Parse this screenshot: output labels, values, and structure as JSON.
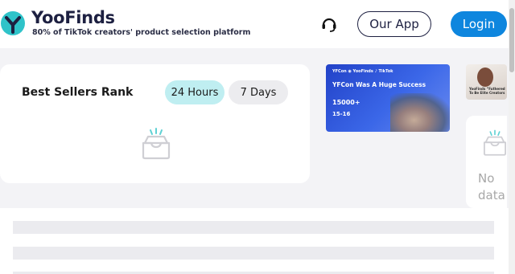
{
  "header": {
    "brand_name": "YooFinds",
    "tagline": "80% of TikTok creators' product selection platform",
    "app_button": "Our App",
    "login_button": "Login",
    "support_icon": "headset-icon"
  },
  "rank": {
    "title": "Best Sellers Rank",
    "tabs": [
      {
        "label": "24 Hours",
        "active": true
      },
      {
        "label": "7 Days",
        "active": false
      }
    ],
    "empty_icon": "empty-box-icon"
  },
  "banner": {
    "top_line": "YFCon  ◉ YooFinds  ♪ TikTok",
    "headline": "YFCon Was A Huge Success",
    "figure": "15000+",
    "date": "15-16"
  },
  "side_banner": {
    "text": "YooFinds “Futhered To Be Elite Creators"
  },
  "side_card": {
    "no_data": "No data"
  },
  "colors": {
    "brand": "#1d2041",
    "accent": "#0e86de",
    "active_tab": "#bfeef1",
    "logo_teal": "#2fc3c9"
  }
}
